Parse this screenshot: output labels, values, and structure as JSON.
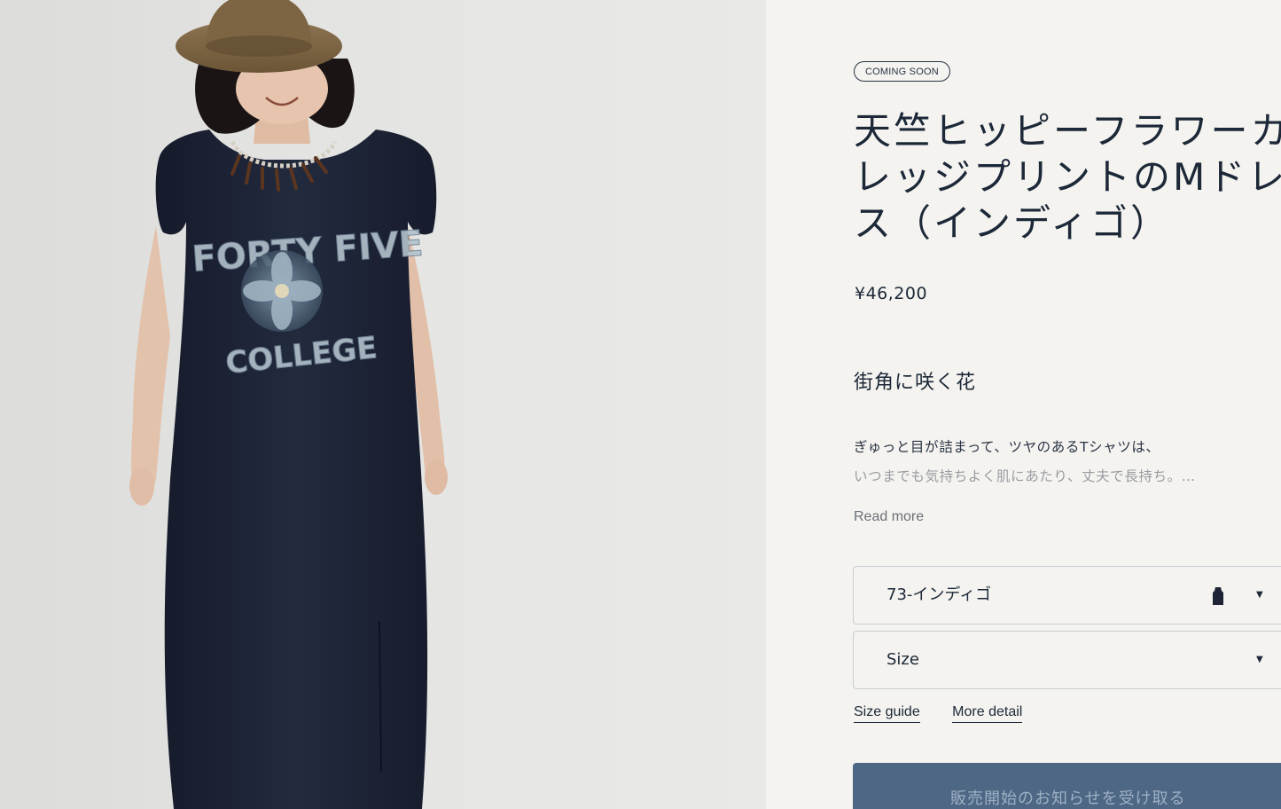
{
  "product": {
    "badge": "COMING SOON",
    "title_lines": [
      "天竺ヒッピーフラワーカ",
      "レッジプリントのMドレ",
      "ス（インディゴ）"
    ],
    "price": "¥46,200",
    "subtitle": "街角に咲く花",
    "description_line1": "ぎゅっと目が詰まって、ツヤのあるTシャツは、",
    "description_line2": "いつまでも気持ちよく肌にあたり、丈夫で長持ち。…",
    "read_more": "Read more"
  },
  "options": {
    "color_value": "73-インディゴ",
    "size_value": "Size",
    "chevron_icon": "chevron-down-icon"
  },
  "links": {
    "size_guide": "Size guide",
    "more_detail": "More detail"
  },
  "cta": {
    "notify_label": "販売開始のお知らせを受け取る"
  },
  "image": {
    "print_text_top": "FORTY FIVE",
    "print_text_bottom": "COLLEGE"
  },
  "colors": {
    "background": "#f4f3ef",
    "text": "#1c2838",
    "button": "#4d6785",
    "dress_indigo": "#1e2436"
  }
}
